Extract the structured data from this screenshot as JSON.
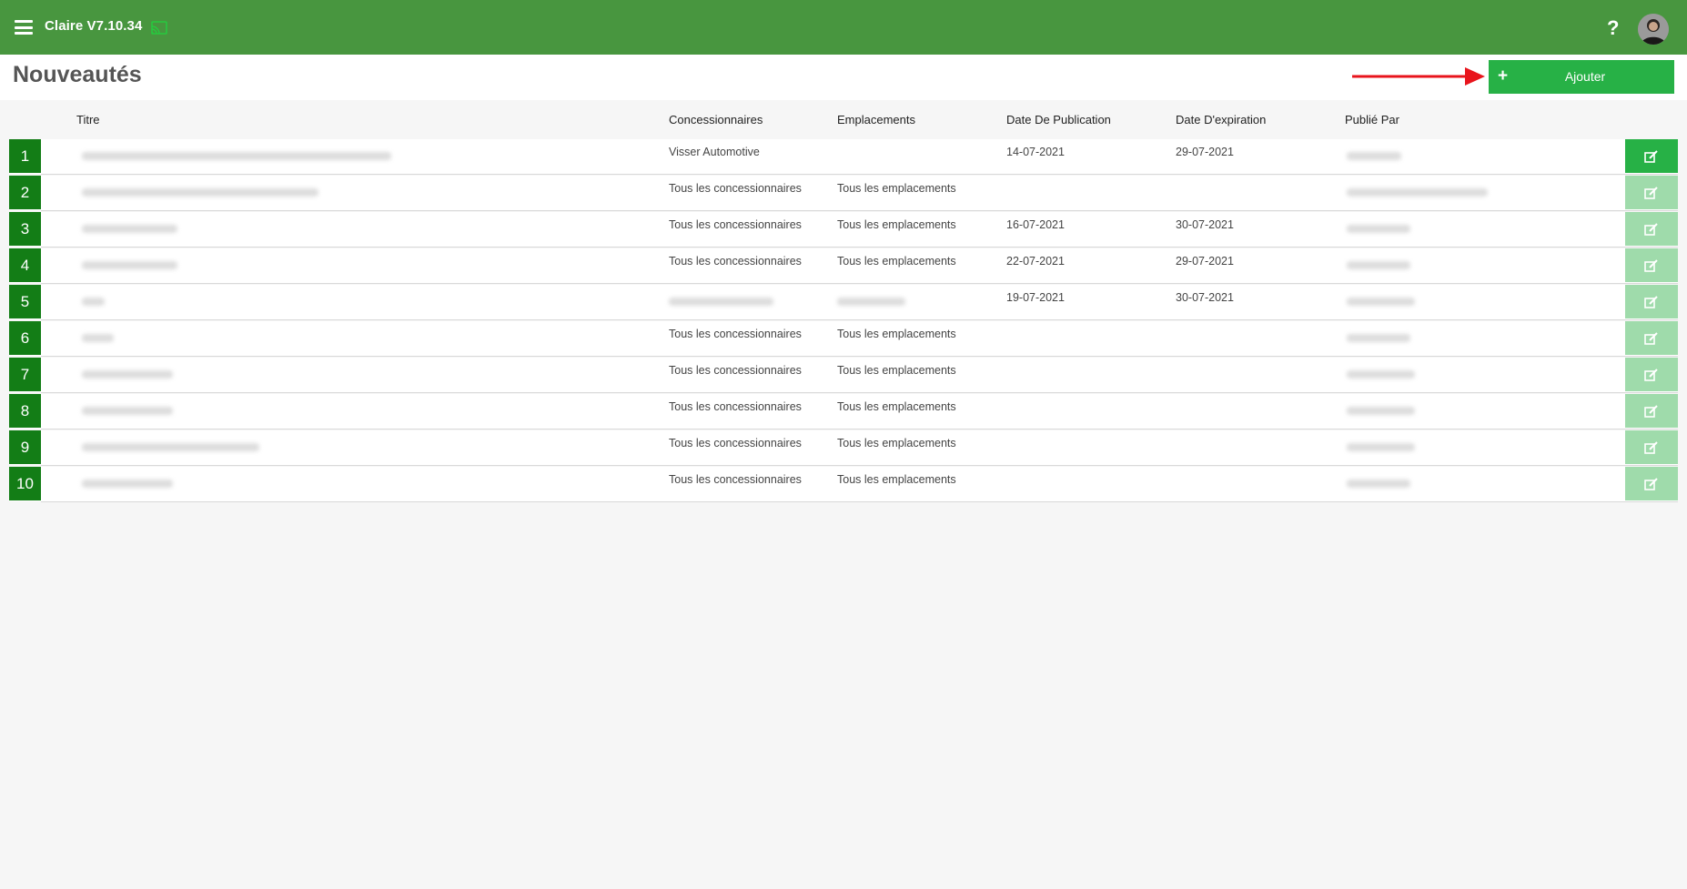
{
  "app": {
    "title": "Claire V7.10.34"
  },
  "header": {
    "title": "Nouveautés",
    "add_label": "Ajouter"
  },
  "icons": {
    "menu": "hamburger-icon",
    "cast": "cast-icon",
    "help": "question-icon",
    "add": "plus-icon",
    "edit": "edit-icon"
  },
  "colors": {
    "topbar": "#48963f",
    "accent": "#27b146",
    "row_number": "#137d16",
    "edit_inactive": "#9fdbab",
    "arrow": "#e8141c"
  },
  "table": {
    "columns": [
      "Titre",
      "Concessionnaires",
      "Emplacements",
      "Date De Publication",
      "Date D'expiration",
      "Publié Par"
    ],
    "rows": [
      {
        "num": "1",
        "dealers": "Visser Automotive",
        "locations": "",
        "pub": "14-07-2021",
        "exp": "29-07-2021",
        "active": true
      },
      {
        "num": "2",
        "dealers": "Tous les concessionnaires",
        "locations": "Tous les emplacements",
        "pub": "",
        "exp": "",
        "active": false
      },
      {
        "num": "3",
        "dealers": "Tous les concessionnaires",
        "locations": "Tous les emplacements",
        "pub": "16-07-2021",
        "exp": "30-07-2021",
        "active": false
      },
      {
        "num": "4",
        "dealers": "Tous les concessionnaires",
        "locations": "Tous les emplacements",
        "pub": "22-07-2021",
        "exp": "29-07-2021",
        "active": false
      },
      {
        "num": "5",
        "dealers": "",
        "locations": "",
        "pub": "19-07-2021",
        "exp": "30-07-2021",
        "active": false
      },
      {
        "num": "6",
        "dealers": "Tous les concessionnaires",
        "locations": "Tous les emplacements",
        "pub": "",
        "exp": "",
        "active": false
      },
      {
        "num": "7",
        "dealers": "Tous les concessionnaires",
        "locations": "Tous les emplacements",
        "pub": "",
        "exp": "",
        "active": false
      },
      {
        "num": "8",
        "dealers": "Tous les concessionnaires",
        "locations": "Tous les emplacements",
        "pub": "",
        "exp": "",
        "active": false
      },
      {
        "num": "9",
        "dealers": "Tous les concessionnaires",
        "locations": "Tous les emplacements",
        "pub": "",
        "exp": "",
        "active": false
      },
      {
        "num": "10",
        "dealers": "Tous les concessionnaires",
        "locations": "Tous les emplacements",
        "pub": "",
        "exp": "",
        "active": false
      }
    ]
  }
}
